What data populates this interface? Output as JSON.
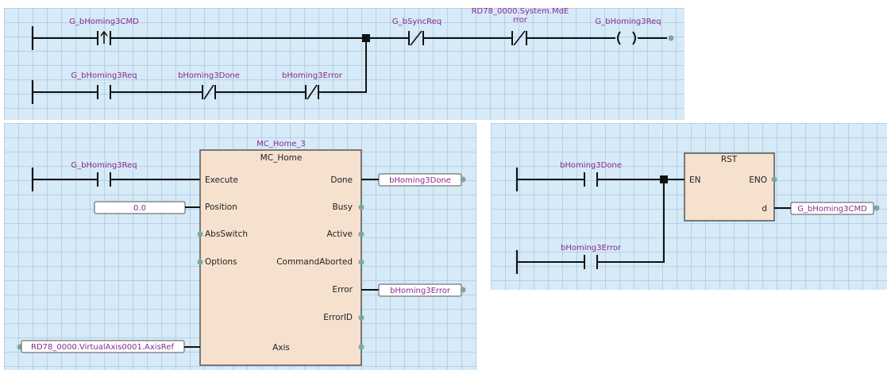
{
  "rung1": {
    "contact_cmd": "G_bHoming3CMD",
    "contact_req": "G_bHoming3Req",
    "contact_done": "bHoming3Done",
    "contact_error": "bHoming3Error",
    "contact_sync": "G_bSyncReq",
    "contact_mderror_line1": "RD78_0000.System.MdE",
    "contact_mderror_line2": "rror",
    "coil_req": "G_bHoming3Req"
  },
  "fb": {
    "instance": "MC_Home_3",
    "type": "MC_Home",
    "input_contact": "G_bHoming3Req",
    "inputs": [
      "Execute",
      "Position",
      "AbsSwitch",
      "Options"
    ],
    "outputs": [
      "Done",
      "Busy",
      "Active",
      "CommandAborted",
      "Error",
      "ErrorID"
    ],
    "axis_label": "Axis",
    "position_value": "0.0",
    "done_var": "bHoming3Done",
    "error_var": "bHoming3Error",
    "axis_var": "RD78_0000.VirtualAxis0001.AxisRef"
  },
  "rst": {
    "title": "RST",
    "en": "EN",
    "eno": "ENO",
    "d": "d",
    "contact_done": "bHoming3Done",
    "contact_error": "bHoming3Error",
    "target_var": "G_bHoming3CMD"
  }
}
